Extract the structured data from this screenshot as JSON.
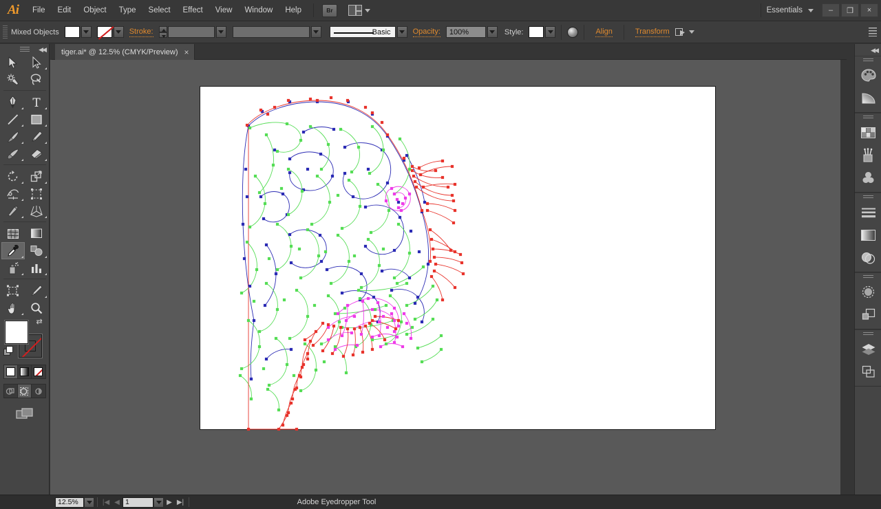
{
  "app": {
    "logo": "Ai",
    "workspace": "Essentials",
    "menu": [
      "File",
      "Edit",
      "Object",
      "Type",
      "Select",
      "Effect",
      "View",
      "Window",
      "Help"
    ],
    "bridge_label": "Br",
    "window_buttons": {
      "minimize": "–",
      "restore": "❐",
      "close": "×"
    }
  },
  "control_bar": {
    "selection_label": "Mixed Objects",
    "fill_swatch": "#ffffff",
    "stroke_swatch": "none",
    "stroke_label": "Stroke:",
    "stroke_weight": "",
    "stroke_profile": "",
    "brush_label": "Basic",
    "opacity_label": "Opacity:",
    "opacity_value": "100%",
    "style_label": "Style:",
    "align_label": "Align",
    "transform_label": "Transform",
    "accent_color": "#e08a2e"
  },
  "tabs": [
    {
      "title": "tiger.ai* @ 12.5% (CMYK/Preview)",
      "close": "×",
      "active": true
    }
  ],
  "toolbar": {
    "groups": [
      [
        {
          "name": "selection-tool",
          "label": "Selection Tool",
          "has_flyout": false,
          "active": false
        },
        {
          "name": "direct-selection-tool",
          "label": "Direct Selection Tool",
          "has_flyout": true,
          "active": false
        },
        {
          "name": "magic-wand-tool",
          "label": "Magic Wand Tool",
          "has_flyout": false,
          "active": false
        },
        {
          "name": "lasso-tool",
          "label": "Lasso Tool",
          "has_flyout": false,
          "active": false
        }
      ],
      [
        {
          "name": "pen-tool",
          "label": "Pen Tool",
          "has_flyout": true,
          "active": false
        },
        {
          "name": "type-tool",
          "label": "Type Tool",
          "has_flyout": true,
          "active": false
        },
        {
          "name": "line-segment-tool",
          "label": "Line Segment Tool",
          "has_flyout": true,
          "active": false
        },
        {
          "name": "rectangle-tool",
          "label": "Rectangle Tool",
          "has_flyout": true,
          "active": false
        },
        {
          "name": "paintbrush-tool",
          "label": "Paintbrush Tool",
          "has_flyout": true,
          "active": false
        },
        {
          "name": "pencil-tool",
          "label": "Pencil Tool",
          "has_flyout": true,
          "active": false
        },
        {
          "name": "blob-brush-tool",
          "label": "Blob Brush Tool",
          "has_flyout": true,
          "active": false
        },
        {
          "name": "eraser-tool",
          "label": "Eraser Tool",
          "has_flyout": true,
          "active": false
        }
      ],
      [
        {
          "name": "rotate-tool",
          "label": "Rotate Tool",
          "has_flyout": true,
          "active": false
        },
        {
          "name": "scale-tool",
          "label": "Scale Tool",
          "has_flyout": true,
          "active": false
        },
        {
          "name": "width-tool",
          "label": "Width Tool",
          "has_flyout": true,
          "active": false
        },
        {
          "name": "free-transform-tool",
          "label": "Free Transform Tool",
          "has_flyout": false,
          "active": false
        },
        {
          "name": "shape-builder-tool",
          "label": "Shape Builder Tool",
          "has_flyout": true,
          "active": false
        },
        {
          "name": "perspective-grid-tool",
          "label": "Perspective Grid Tool",
          "has_flyout": true,
          "active": false
        }
      ],
      [
        {
          "name": "mesh-tool",
          "label": "Mesh Tool",
          "has_flyout": false,
          "active": false
        },
        {
          "name": "gradient-tool",
          "label": "Gradient Tool",
          "has_flyout": false,
          "active": false
        },
        {
          "name": "eyedropper-tool",
          "label": "Eyedropper Tool",
          "has_flyout": true,
          "active": true
        },
        {
          "name": "blend-tool",
          "label": "Blend Tool",
          "has_flyout": true,
          "active": false
        },
        {
          "name": "symbol-sprayer-tool",
          "label": "Symbol Sprayer Tool",
          "has_flyout": true,
          "active": false
        },
        {
          "name": "column-graph-tool",
          "label": "Column Graph Tool",
          "has_flyout": true,
          "active": false
        }
      ],
      [
        {
          "name": "artboard-tool",
          "label": "Artboard Tool",
          "has_flyout": false,
          "active": false
        },
        {
          "name": "slice-tool",
          "label": "Slice Tool",
          "has_flyout": true,
          "active": false
        },
        {
          "name": "hand-tool",
          "label": "Hand Tool",
          "has_flyout": true,
          "active": false
        },
        {
          "name": "zoom-tool",
          "label": "Zoom Tool",
          "has_flyout": false,
          "active": false
        }
      ]
    ],
    "fill_stroke": {
      "fill_color": "#ffffff",
      "stroke_color": "none",
      "swap_icon": "⇄",
      "color_mode": "color",
      "modes": [
        "color",
        "gradient",
        "none"
      ],
      "draw_modes": [
        "draw-normal",
        "draw-behind",
        "draw-inside"
      ],
      "draw_mode_selected": "draw-behind",
      "screen_mode": "change-screen-mode"
    }
  },
  "dock": {
    "groups": [
      [
        "color-panel-icon",
        "color-guide-icon"
      ],
      [
        "swatches-panel-icon",
        "brushes-panel-icon",
        "symbols-panel-icon"
      ],
      [
        "stroke-panel-icon",
        "gradient-panel-icon",
        "transparency-panel-icon"
      ],
      [
        "appearance-panel-icon",
        "graphic-styles-panel-icon"
      ],
      [
        "layers-panel-icon",
        "artboards-panel-icon"
      ]
    ]
  },
  "status_bar": {
    "zoom_level": "12.5%",
    "page_number": "1",
    "tool_name": "Adobe Eyedropper Tool"
  },
  "canvas": {
    "background": "#595959",
    "artboard_color": "#ffffff",
    "artwork_title": "tiger head vector outlines",
    "anchor_colors": {
      "fur_layer": "#55dd55",
      "head_outline_layer": "#2b2bb4",
      "whiskers_layer": "#e8342c",
      "muzzle_layer": "#ee3ce8"
    }
  }
}
